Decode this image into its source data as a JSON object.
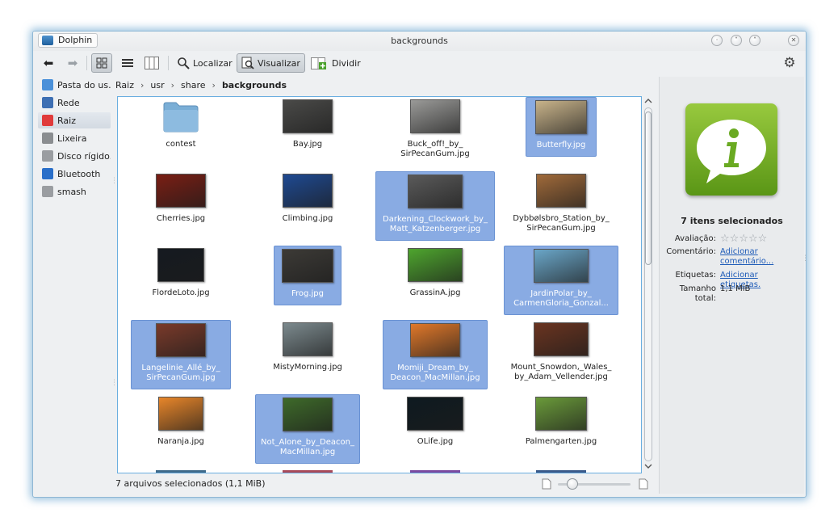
{
  "window": {
    "app_name": "Dolphin",
    "title": "backgrounds"
  },
  "toolbar": {
    "find_label": "Localizar",
    "preview_label": "Visualizar",
    "split_label": "Dividir"
  },
  "places": [
    {
      "label": "Pasta do us...",
      "icon": "home-folder-icon",
      "color": "#4a90d9"
    },
    {
      "label": "Rede",
      "icon": "network-icon",
      "color": "#3d6fb3"
    },
    {
      "label": "Raiz",
      "icon": "root-folder-icon",
      "color": "#e03a3a"
    },
    {
      "label": "Lixeira",
      "icon": "trash-icon",
      "color": "#8a8d90"
    },
    {
      "label": "Disco rígido...",
      "icon": "hard-disk-icon",
      "color": "#9a9da1"
    },
    {
      "label": "Bluetooth",
      "icon": "bluetooth-icon",
      "color": "#2a6fc9"
    },
    {
      "label": "smash",
      "icon": "drive-icon",
      "color": "#9a9da1"
    }
  ],
  "breadcrumb": [
    "Raiz",
    "usr",
    "share",
    "backgrounds"
  ],
  "files": [
    {
      "name": "contest",
      "type": "folder",
      "selected": false,
      "color": "#7aaed6"
    },
    {
      "name": "Bay.jpg",
      "type": "image",
      "selected": false,
      "color": "#4a4a48"
    },
    {
      "name": "Buck_off!_by_\nSirPecanGum.jpg",
      "type": "image",
      "selected": false,
      "color": "#9a9a98"
    },
    {
      "name": "Butterfly.jpg",
      "type": "image",
      "selected": true,
      "color": "#c8b38a"
    },
    {
      "name": "Cherries.jpg",
      "type": "image",
      "selected": false,
      "color": "#7a1e14"
    },
    {
      "name": "Climbing.jpg",
      "type": "image",
      "selected": false,
      "color": "#1f4a92"
    },
    {
      "name": "Darkening_Clockwork_by_\nMatt_Katzenberger.jpg",
      "type": "image",
      "selected": true,
      "color": "#5a5a5a"
    },
    {
      "name": "Dybbølsbro_Station_by_\nSirPecanGum.jpg",
      "type": "image",
      "selected": false,
      "color": "#a06a3a"
    },
    {
      "name": "FlordeLoto.jpg",
      "type": "image",
      "selected": false,
      "color": "#151a20"
    },
    {
      "name": "Frog.jpg",
      "type": "image",
      "selected": true,
      "color": "#3c3a36"
    },
    {
      "name": "GrassinA.jpg",
      "type": "image",
      "selected": false,
      "color": "#4ea52e"
    },
    {
      "name": "JardinPolar_by_\nCarmenGloria_Gonzal...",
      "type": "image",
      "selected": true,
      "color": "#6aa6c8"
    },
    {
      "name": "Langelinie_Allé_by_\nSirPecanGum.jpg",
      "type": "image",
      "selected": true,
      "color": "#7a3a2a"
    },
    {
      "name": "MistyMorning.jpg",
      "type": "image",
      "selected": false,
      "color": "#7c8a8e"
    },
    {
      "name": "Momiji_Dream_by_\nDeacon_MacMillan.jpg",
      "type": "image",
      "selected": true,
      "color": "#e0782a"
    },
    {
      "name": "Mount_Snowdon,_Wales_\nby_Adam_Vellender.jpg",
      "type": "image",
      "selected": false,
      "color": "#6a3420"
    },
    {
      "name": "Naranja.jpg",
      "type": "image",
      "selected": false,
      "color": "#e8862a"
    },
    {
      "name": "Not_Alone_by_Deacon_\nMacMillan.jpg",
      "type": "image",
      "selected": true,
      "color": "#3e6a2a"
    },
    {
      "name": "OLife.jpg",
      "type": "image",
      "selected": false,
      "color": "#0e1a20"
    },
    {
      "name": "Palmengarten.jpg",
      "type": "image",
      "selected": false,
      "color": "#6a9a3a"
    }
  ],
  "status": {
    "text": "7 arquivos selecionados (1,1 MiB)",
    "zoom_fraction": 0.2
  },
  "info_panel": {
    "title": "7 itens selecionados",
    "rating_label": "Avaliação:",
    "rating_stars": 0,
    "rating_max": 5,
    "comment_label": "Comentário:",
    "comment_link": "Adicionar comentário...",
    "tags_label": "Etiquetas:",
    "tags_link": "Adicionar etiquetas.",
    "size_label": "Tamanho total:",
    "size_value": "1,1 MiB",
    "icon": "information-icon",
    "icon_color": "#6aaa22"
  }
}
